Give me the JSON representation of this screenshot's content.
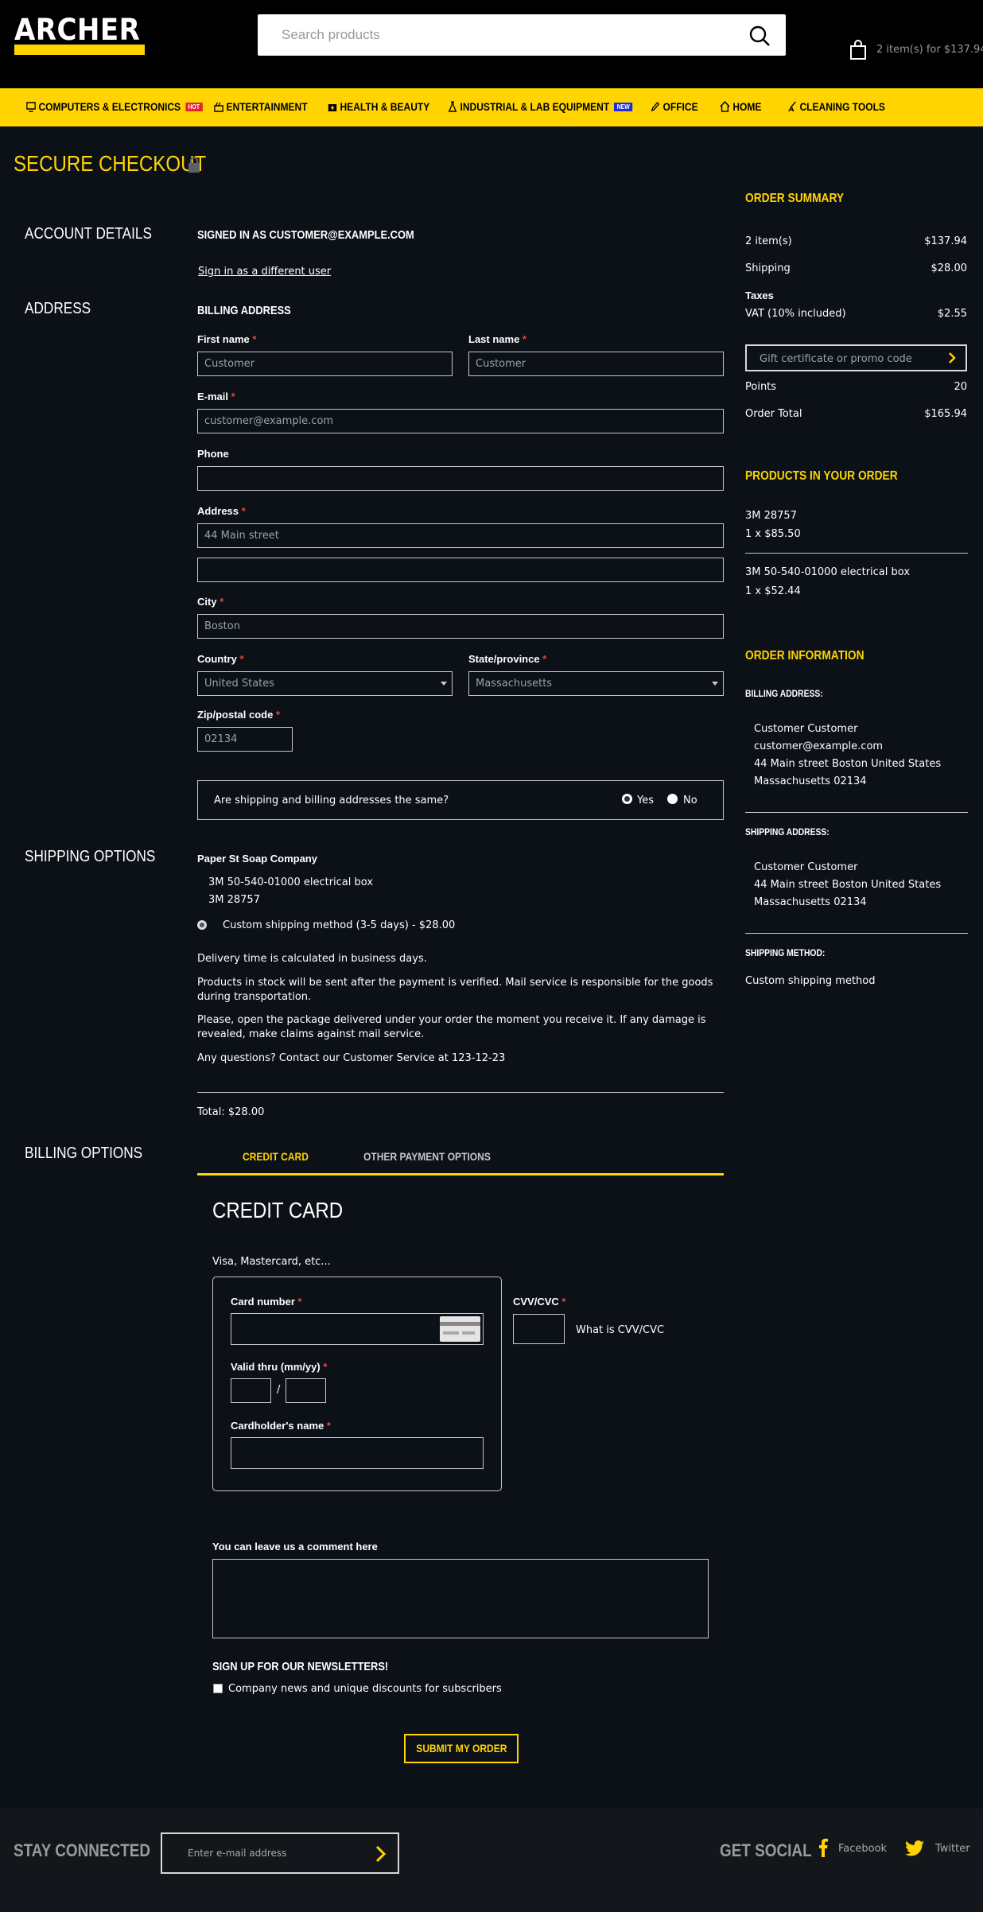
{
  "header": {
    "logo": "ARCHER",
    "search_placeholder": "Search products",
    "cart_label": "2 item(s) for $137.94"
  },
  "nav": [
    {
      "label": "COMPUTERS & ELECTRONICS",
      "badge": "HOT",
      "badge_color": "#e8242a"
    },
    {
      "label": "ENTERTAINMENT"
    },
    {
      "label": "HEALTH & BEAUTY"
    },
    {
      "label": "INDUSTRIAL & LAB EQUIPMENT",
      "badge": "NEW",
      "badge_color": "#1f2fd6"
    },
    {
      "label": "OFFICE"
    },
    {
      "label": "HOME"
    },
    {
      "label": "CLEANING TOOLS"
    }
  ],
  "page_title": "SECURE CHECKOUT",
  "account": {
    "section": "ACCOUNT DETAILS",
    "signed_in": "SIGNED IN AS CUSTOMER@EXAMPLE.COM",
    "switch_link": "Sign in as a different user"
  },
  "address": {
    "section": "ADDRESS",
    "heading": "BILLING ADDRESS",
    "first_name_label": "First name",
    "first_name": "Customer",
    "last_name_label": "Last name",
    "last_name": "Customer",
    "email_label": "E-mail",
    "email": "customer@example.com",
    "phone_label": "Phone",
    "phone": "",
    "address_label": "Address",
    "address1": "44 Main street",
    "address2": "",
    "city_label": "City",
    "city": "Boston",
    "country_label": "Country",
    "country": "United States",
    "state_label": "State/province",
    "state": "Massachusetts",
    "zip_label": "Zip/postal code",
    "zip": "02134",
    "same_question": "Are shipping and billing addresses the same?",
    "yes": "Yes",
    "no": "No"
  },
  "shipping": {
    "section": "SHIPPING OPTIONS",
    "vendor": "Paper St Soap Company",
    "items": [
      "3M 50-540-01000 electrical box",
      "3M 28757"
    ],
    "method": "Custom shipping method (3-5 days) - $28.00",
    "notes": [
      "Delivery time is calculated in business days.",
      "Products in stock will be sent after the payment is verified. Mail service is responsible for the goods during transportation.",
      "Please, open the package delivered under your order the moment you receive it. If any damage is revealed, make claims against mail service.",
      "Any questions? Contact our Customer Service at 123-12-23"
    ],
    "total": "Total: $28.00"
  },
  "billing": {
    "section": "BILLING OPTIONS",
    "tab_credit": "CREDIT CARD",
    "tab_other": "OTHER PAYMENT OPTIONS",
    "heading": "CREDIT CARD",
    "cards_note": "Visa, Mastercard, etc...",
    "card_number_label": "Card number",
    "cvv_label": "CVV/CVC",
    "cvv_help": "What is CVV/CVC",
    "valid_label": "Valid thru (mm/yy)",
    "slash": "/",
    "holder_label": "Cardholder's name",
    "comment_label": "You can leave us a comment here",
    "newsletter_heading": "SIGN UP FOR OUR NEWSLETTERS!",
    "newsletter_option": "Company news and unique discounts for subscribers",
    "submit": "SUBMIT MY ORDER"
  },
  "summary": {
    "heading": "ORDER SUMMARY",
    "items_label": "2 item(s)",
    "items_value": "$137.94",
    "shipping_label": "Shipping",
    "shipping_value": "$28.00",
    "taxes_label": "Taxes",
    "vat_label": "VAT (10% included)",
    "vat_value": "$2.55",
    "promo_placeholder": "Gift certificate or promo code",
    "points_label": "Points",
    "points_value": "20",
    "total_label": "Order Total",
    "total_value": "$165.94"
  },
  "products": {
    "heading": "PRODUCTS IN YOUR ORDER",
    "list": [
      {
        "name": "3M 28757",
        "qty": "1 x $85.50"
      },
      {
        "name": "3M 50-540-01000 electrical box",
        "qty": "1 x $52.44"
      }
    ]
  },
  "order_info": {
    "heading": "ORDER INFORMATION",
    "billing_heading": "BILLING ADDRESS:",
    "billing_lines": [
      "Customer  Customer",
      "customer@example.com",
      "44 Main street  Boston  United States",
      "Massachusetts  02134"
    ],
    "shipping_heading": "SHIPPING ADDRESS:",
    "shipping_lines": [
      "Customer  Customer",
      "44 Main street  Boston  United States",
      "Massachusetts  02134"
    ],
    "method_heading": "SHIPPING METHOD:",
    "method": "Custom shipping method"
  },
  "footer": {
    "stay_connected": "STAY CONNECTED",
    "email_placeholder": "Enter e-mail address",
    "get_social": "GET SOCIAL",
    "facebook": "Facebook",
    "twitter": "Twitter"
  }
}
